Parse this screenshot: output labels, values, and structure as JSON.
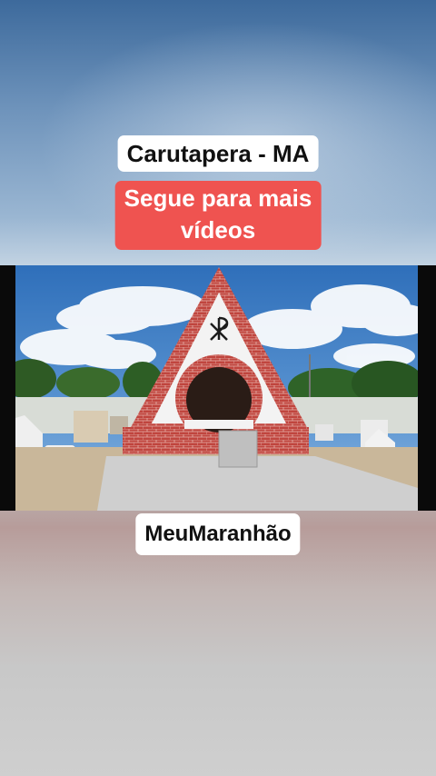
{
  "captions": {
    "location": "Carutapera - MA",
    "follow_line1": "Segue para mais",
    "follow_line2": "vídeos",
    "brand": "MeuMaranhão"
  },
  "photo": {
    "subject": "chi-rho-icon"
  },
  "colors": {
    "follow_badge": "#ef5350",
    "caption_bg": "#ffffff",
    "caption_text": "#111111",
    "brick": "#c0453e",
    "sky": "#3b7cc4"
  }
}
